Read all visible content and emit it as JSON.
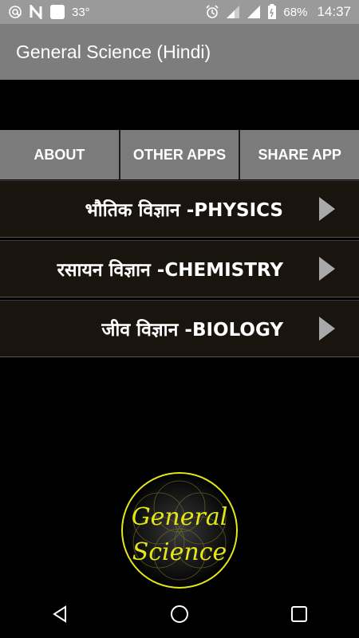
{
  "status_bar": {
    "temperature": "33°",
    "battery": "68%",
    "time": "14:37",
    "icons": [
      "at-sign-icon",
      "n-notification-icon",
      "white-square-icon",
      "alarm-icon",
      "signal-icon",
      "wifi-icon",
      "battery-icon"
    ]
  },
  "app_bar": {
    "title": "General Science (Hindi)"
  },
  "top_buttons": [
    {
      "label": "ABOUT"
    },
    {
      "label": "OTHER APPS"
    },
    {
      "label": "SHARE APP"
    }
  ],
  "menu": [
    {
      "label": "भौतिक विज्ञान -PHYSICS"
    },
    {
      "label": "रसायन विज्ञान -CHEMISTRY"
    },
    {
      "label": "जीव विज्ञान -BIOLOGY"
    }
  ],
  "logo": {
    "line1": "General",
    "line2": "Science"
  },
  "colors": {
    "status_bar": "#9a9a9a",
    "app_bar": "#7d7d7d",
    "button": "#7b7b7b",
    "menu_item": "#1a140f",
    "logo_yellow": "#e5e619"
  }
}
